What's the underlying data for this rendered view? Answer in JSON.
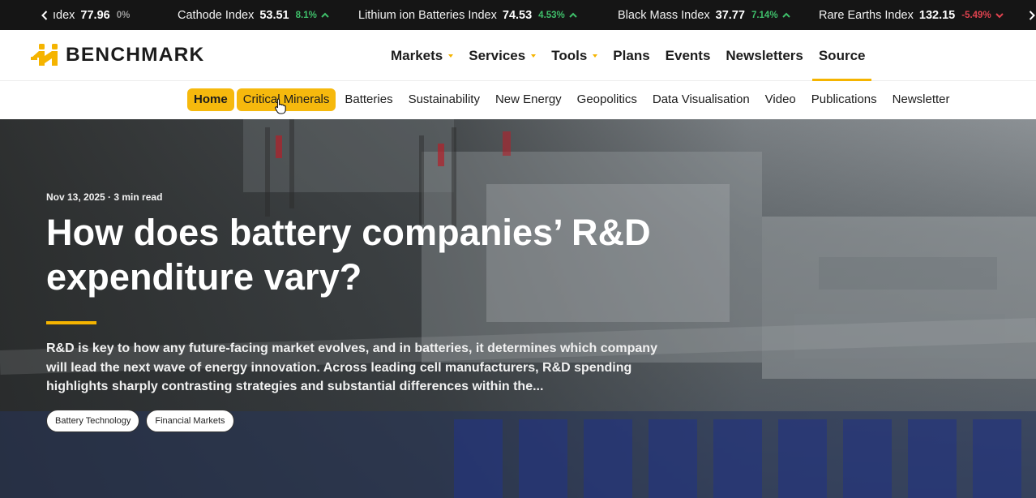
{
  "ticker": {
    "items": [
      {
        "name": "ıdex",
        "value": "77.96",
        "change": "0%",
        "trend": "flat"
      },
      {
        "name": "Cathode Index",
        "value": "53.51",
        "change": "8.1%",
        "trend": "up"
      },
      {
        "name": "Lithium ion Batteries Index",
        "value": "74.53",
        "change": "4.53%",
        "trend": "up"
      },
      {
        "name": "Black Mass Index",
        "value": "37.77",
        "change": "7.14%",
        "trend": "up"
      },
      {
        "name": "Rare Earths Index",
        "value": "132.15",
        "change": "-5.49%",
        "trend": "down"
      }
    ],
    "prev_icon": "chevron-left-icon",
    "next_icon": "chevron-right-icon"
  },
  "header": {
    "logo_text": "BENCHMARK",
    "nav": [
      {
        "label": "Markets",
        "dropdown": true
      },
      {
        "label": "Services",
        "dropdown": true
      },
      {
        "label": "Tools",
        "dropdown": true
      },
      {
        "label": "Plans",
        "dropdown": false
      },
      {
        "label": "Events",
        "dropdown": false
      },
      {
        "label": "Newsletters",
        "dropdown": false
      },
      {
        "label": "Source",
        "dropdown": false,
        "active": true
      }
    ]
  },
  "subnav": {
    "items": [
      {
        "label": "Home",
        "highlight": true
      },
      {
        "label": "Critical Minerals",
        "highlight": true
      },
      {
        "label": "Batteries"
      },
      {
        "label": "Sustainability"
      },
      {
        "label": "New Energy"
      },
      {
        "label": "Geopolitics"
      },
      {
        "label": "Data Visualisation"
      },
      {
        "label": "Video"
      },
      {
        "label": "Publications"
      },
      {
        "label": "Newsletter"
      }
    ]
  },
  "hero": {
    "date": "Nov 13, 2025 · 3 min read",
    "title": "How does battery companies’ R&D expenditure vary?",
    "summary": "R&D is key to how any future-facing market evolves, and in batteries, it determines which company will lead the next wave of energy innovation. Across leading cell manufacturers, R&D spending highlights sharply contrasting strategies and substantial differences within the...",
    "tags": [
      "Battery Technology",
      "Financial Markets"
    ]
  },
  "colors": {
    "accent": "#f5b400",
    "ticker_bg": "#151515",
    "up": "#3fbf6a",
    "down": "#e0434f"
  }
}
